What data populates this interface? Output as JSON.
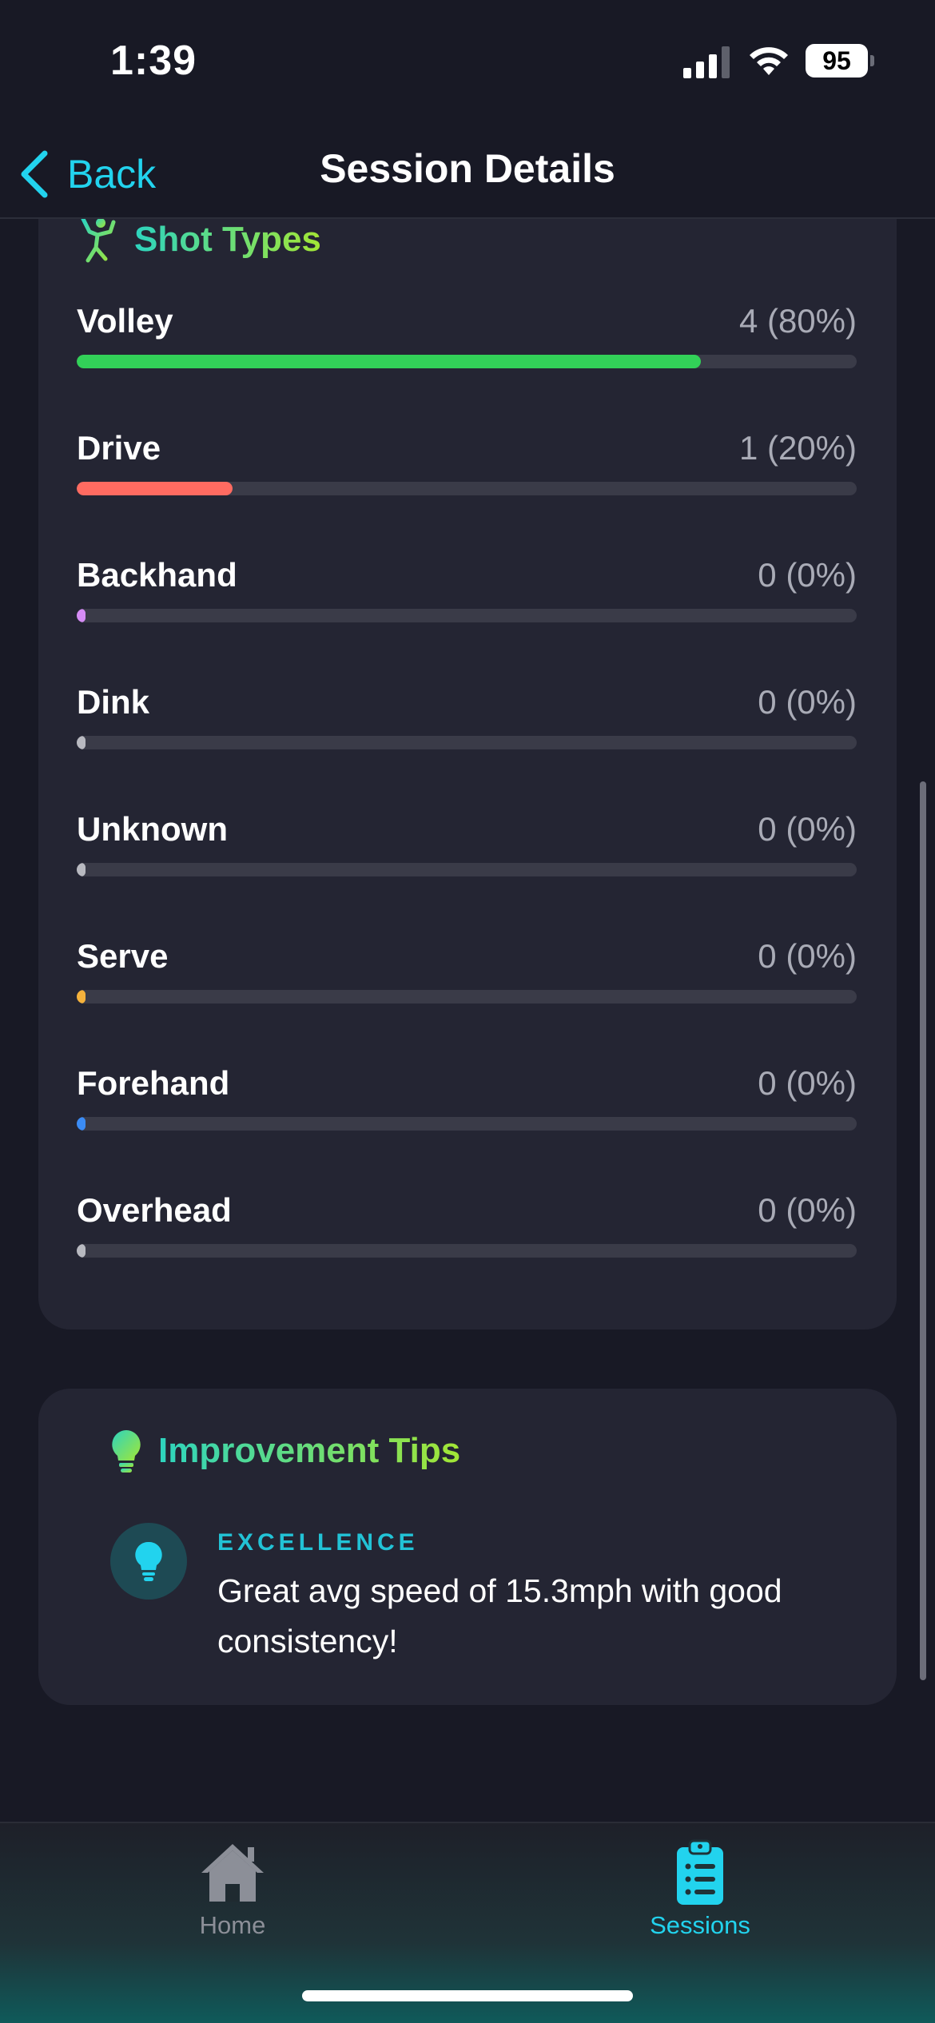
{
  "status_bar": {
    "time": "1:39",
    "battery": "95"
  },
  "nav": {
    "back_label": "Back",
    "title": "Session Details"
  },
  "shot_types": {
    "title": "Shot Types",
    "icon": "player-icon",
    "items": [
      {
        "label": "Volley",
        "value": "4 (80%)",
        "fraction": 0.8,
        "color": "#32d158"
      },
      {
        "label": "Drive",
        "value": "1 (20%)",
        "fraction": 0.2,
        "color": "#ff6b61"
      },
      {
        "label": "Backhand",
        "value": "0 (0%)",
        "fraction": 0,
        "color": "#d58cf5"
      },
      {
        "label": "Dink",
        "value": "0 (0%)",
        "fraction": 0,
        "color": "#b8b9c0"
      },
      {
        "label": "Unknown",
        "value": "0 (0%)",
        "fraction": 0,
        "color": "#b8b9c0"
      },
      {
        "label": "Serve",
        "value": "0 (0%)",
        "fraction": 0,
        "color": "#f5b23c"
      },
      {
        "label": "Forehand",
        "value": "0 (0%)",
        "fraction": 0,
        "color": "#3b8cf5"
      },
      {
        "label": "Overhead",
        "value": "0 (0%)",
        "fraction": 0,
        "color": "#b8b9c0"
      }
    ]
  },
  "tips": {
    "title": "Improvement Tips",
    "icon": "lightbulb-icon",
    "items": [
      {
        "category": "EXCELLENCE",
        "text": "Great avg speed of 15.3mph with good consistency!",
        "icon": "lightbulb-icon"
      }
    ]
  },
  "tab_bar": {
    "tabs": [
      {
        "label": "Home",
        "icon": "home-icon",
        "active": false
      },
      {
        "label": "Sessions",
        "icon": "clipboard-list-icon",
        "active": true
      }
    ]
  },
  "colors": {
    "accent": "#22d3ee",
    "background": "#181925",
    "card": "#242533",
    "track": "#3a3b48"
  }
}
